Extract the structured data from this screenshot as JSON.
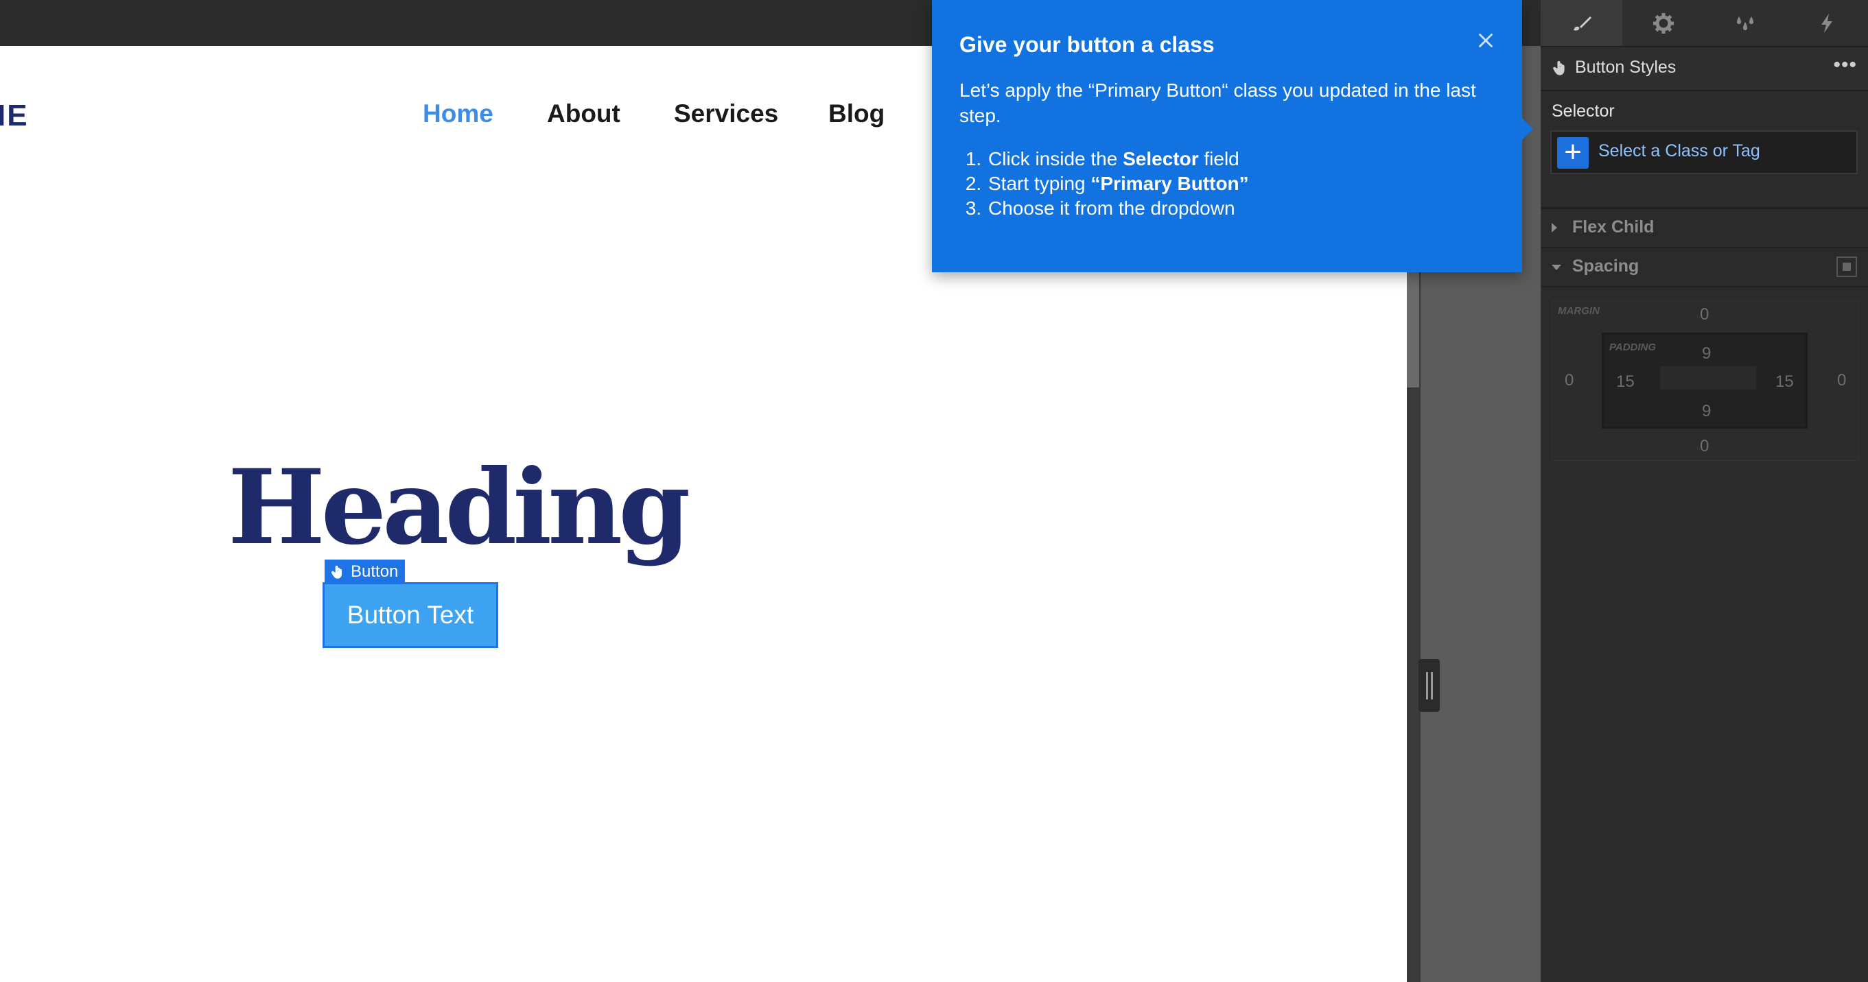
{
  "canvas": {
    "logo_text": "IE",
    "nav": [
      "Home",
      "About",
      "Services",
      "Blog"
    ],
    "heading": "Heading",
    "element_label": "Button",
    "button_text": "Button Text"
  },
  "tooltip": {
    "title": "Give your button a class",
    "body": "Let’s apply the “Primary Button“ class you updated in the last step.",
    "step1_pre": "Click inside the ",
    "step1_bold": "Selector",
    "step1_post": " field",
    "step2_pre": "Start typing ",
    "step2_bold": "“Primary Button”",
    "step3": "Choose it from the dropdown",
    "close_icon": "close-icon"
  },
  "panel": {
    "tabs": [
      "brush-icon",
      "gear-icon",
      "drops-icon",
      "lightning-icon"
    ],
    "styles_title": "Button Styles",
    "more_label": "•••",
    "selector_label": "Selector",
    "selector_placeholder": "Select a Class or Tag",
    "sections": [
      "Flex Child",
      "Spacing"
    ],
    "spacing": {
      "margin_label": "MARGIN",
      "padding_label": "PADDING",
      "margin": {
        "top": "0",
        "right": "0",
        "bottom": "0",
        "left": "0"
      },
      "padding": {
        "top": "9",
        "right": "15",
        "bottom": "9",
        "left": "15"
      }
    }
  },
  "colors": {
    "accent": "#1272e0",
    "heading": "#1f2a6b",
    "nav_active": "#3d8de6",
    "button": "#3da2f0",
    "panel_bg": "#2b2b2b"
  }
}
